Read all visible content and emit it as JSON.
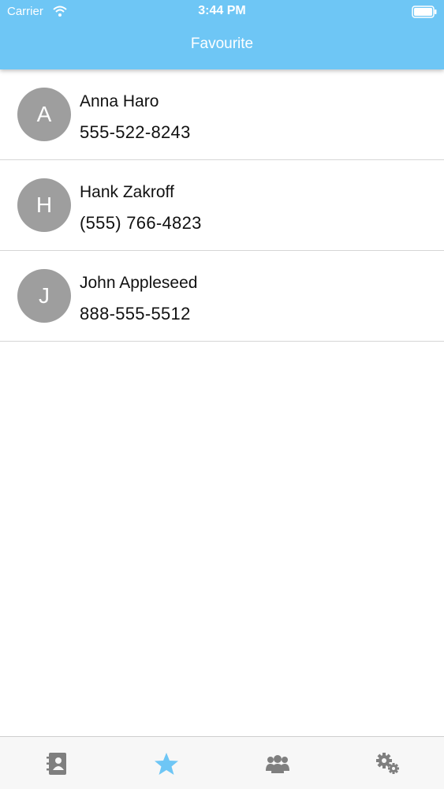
{
  "status_bar": {
    "carrier": "Carrier",
    "time": "3:44 PM"
  },
  "nav": {
    "title": "Favourite"
  },
  "contacts": [
    {
      "initial": "A",
      "name": "Anna Haro",
      "phone": "555-522-8243"
    },
    {
      "initial": "H",
      "name": "Hank Zakroff",
      "phone": "(555) 766-4823"
    },
    {
      "initial": "J",
      "name": "John Appleseed",
      "phone": "888-555-5512"
    }
  ],
  "tabs": [
    {
      "icon": "contacts-book-icon",
      "active": false
    },
    {
      "icon": "star-icon",
      "active": true
    },
    {
      "icon": "group-icon",
      "active": false
    },
    {
      "icon": "settings-gears-icon",
      "active": false
    }
  ],
  "colors": {
    "accent": "#6ec6f5",
    "avatar": "#9e9e9e",
    "tab_inactive": "#7f7f7f"
  }
}
